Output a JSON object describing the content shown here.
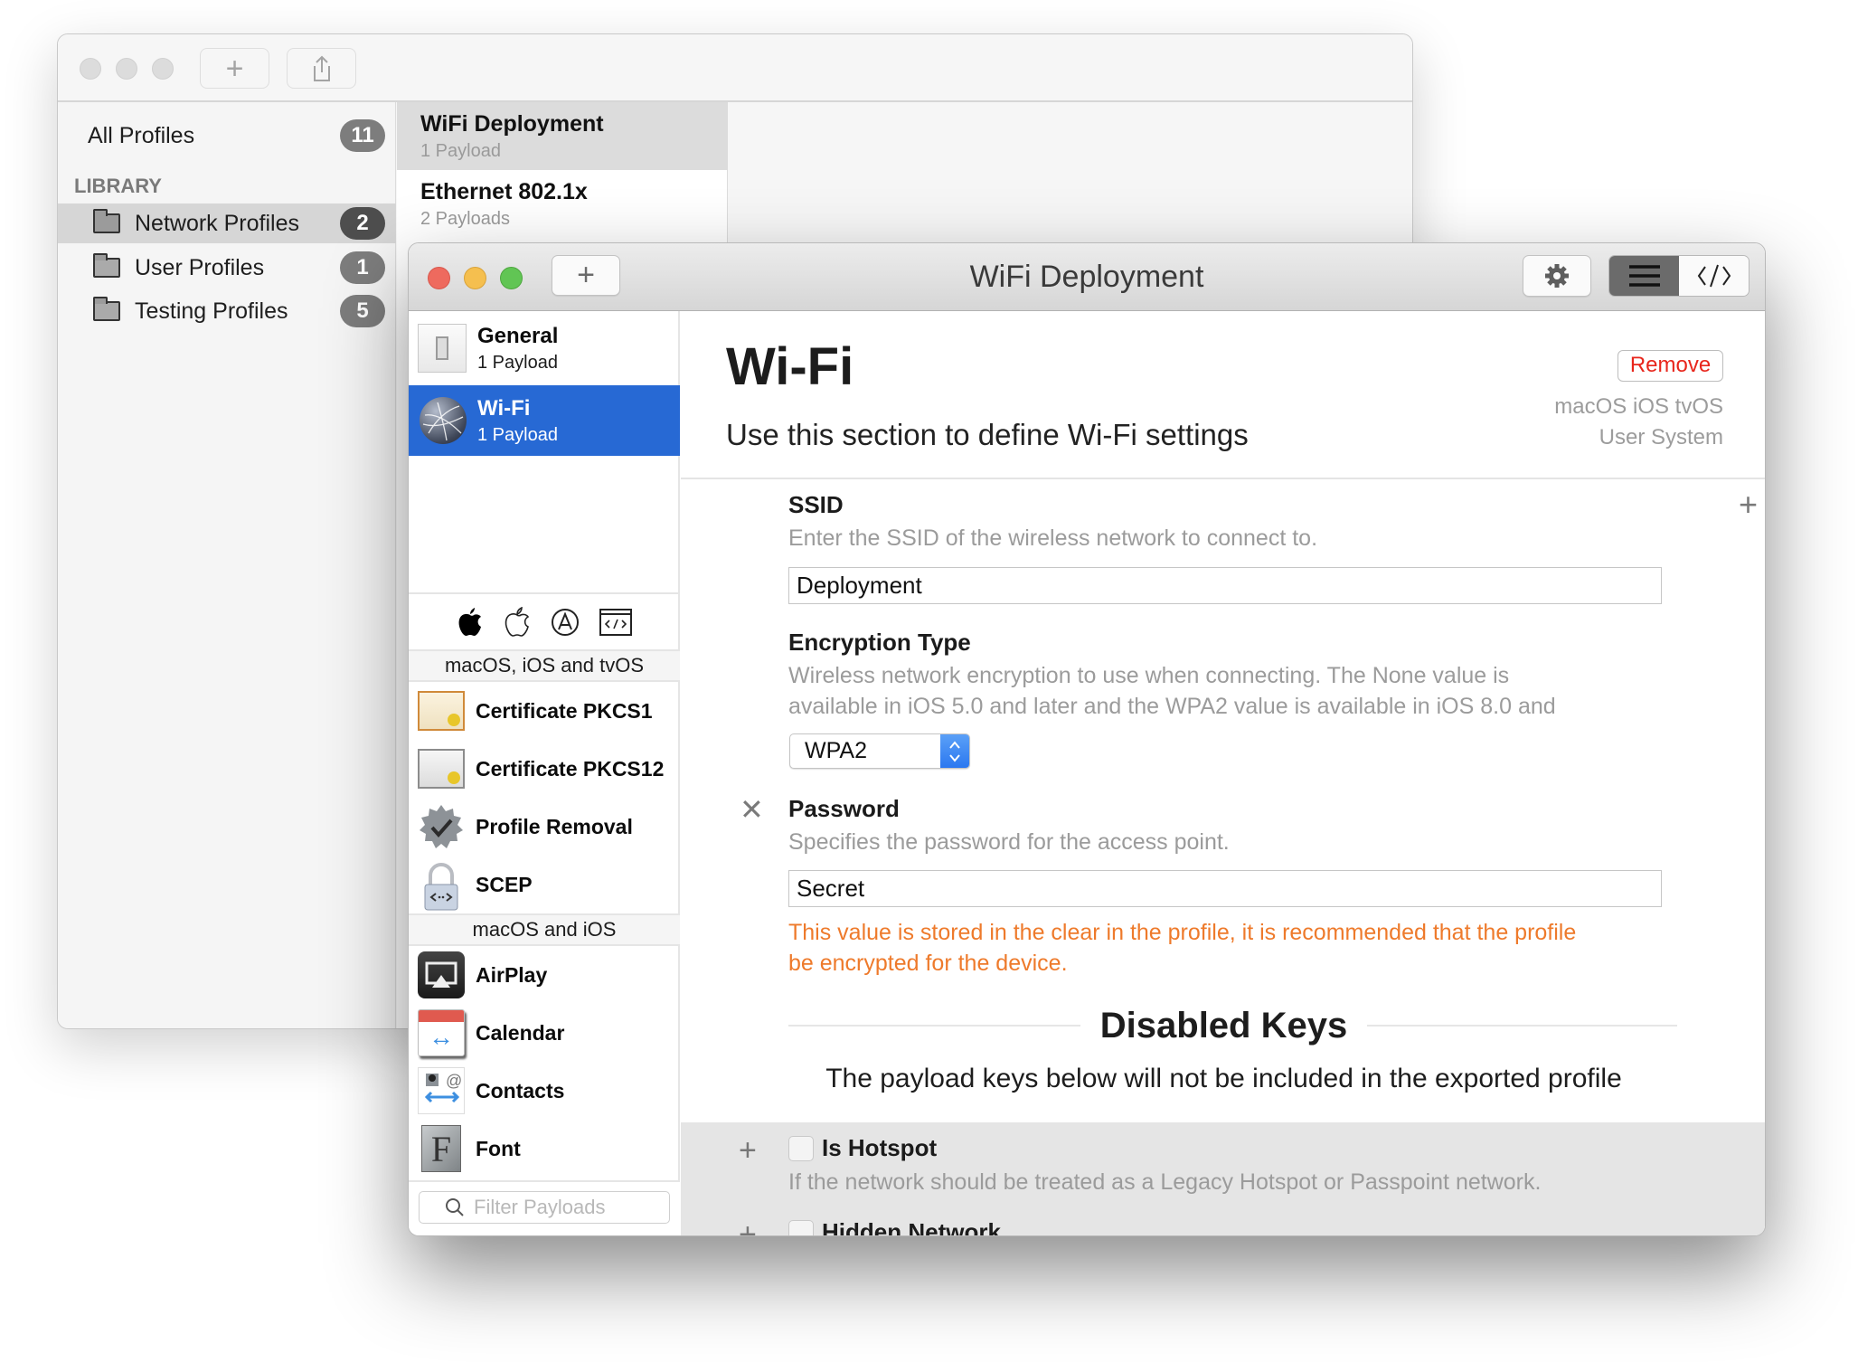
{
  "back_window": {
    "toolbar": {
      "add_icon": "plus-icon",
      "share_icon": "share-icon"
    },
    "sidebar": {
      "all_profiles": {
        "label": "All Profiles",
        "count": "11"
      },
      "section_header": "LIBRARY",
      "items": [
        {
          "label": "Network Profiles",
          "count": "2",
          "selected": true
        },
        {
          "label": "User Profiles",
          "count": "1"
        },
        {
          "label": "Testing Profiles",
          "count": "5"
        }
      ]
    },
    "profiles": [
      {
        "title": "WiFi Deployment",
        "subtitle": "1 Payload",
        "selected": true
      },
      {
        "title": "Ethernet 802.1x",
        "subtitle": "2 Payloads"
      }
    ]
  },
  "front_window": {
    "title": "WiFi Deployment",
    "toolbar": {
      "add_icon": "plus-icon",
      "settings_icon": "gear-icon",
      "view_mode_editor_icon": "list-icon",
      "view_mode_source_icon": "code-icon",
      "active_view": "editor"
    },
    "payloads": [
      {
        "title": "General",
        "subtitle": "1 Payload"
      },
      {
        "title": "Wi-Fi",
        "subtitle": "1 Payload",
        "selected": true
      }
    ],
    "platform_filters": [
      "macos-icon",
      "ios-icon",
      "tvos-icon",
      "custom-icon"
    ],
    "library_groups": [
      {
        "header": "macOS, iOS and tvOS",
        "items": [
          "Certificate PKCS1",
          "Certificate PKCS12",
          "Profile Removal",
          "SCEP"
        ]
      },
      {
        "header": "macOS and iOS",
        "items": [
          "AirPlay",
          "Calendar",
          "Contacts",
          "Font"
        ]
      }
    ],
    "filter": {
      "placeholder": "Filter Payloads",
      "value": ""
    },
    "editor": {
      "title": "Wi-Fi",
      "subtitle": "Use this section to define Wi-Fi settings",
      "remove_label": "Remove",
      "platforms": "macOS iOS tvOS",
      "scope": "User System",
      "accent_red": "#e8261c",
      "warning_color": "#ee7a2b",
      "fields": {
        "ssid": {
          "label": "SSID",
          "description": "Enter the SSID of the wireless network to connect to.",
          "value": "Deployment"
        },
        "encryption": {
          "label": "Encryption Type",
          "description_1": "Wireless network encryption to use when connecting. The None value is",
          "description_2": "available in iOS 5.0 and later and the WPA2 value is available in iOS 8.0 and",
          "value": "WPA2"
        },
        "password": {
          "label": "Password",
          "description": "Specifies the password for the access point.",
          "value": "Secret",
          "warning_1": "This value is stored in the clear in the profile, it is recommended that the profile",
          "warning_2": "be encrypted for the device."
        }
      },
      "disabled_keys": {
        "title": "Disabled Keys",
        "subtitle": "The payload keys below will not be included in the exported profile",
        "items": [
          {
            "label": "Is Hotspot",
            "description": "If the network should be treated as a Legacy Hotspot or Passpoint network.",
            "checked": false
          },
          {
            "label": "Hidden Network",
            "checked": false
          }
        ]
      }
    }
  }
}
